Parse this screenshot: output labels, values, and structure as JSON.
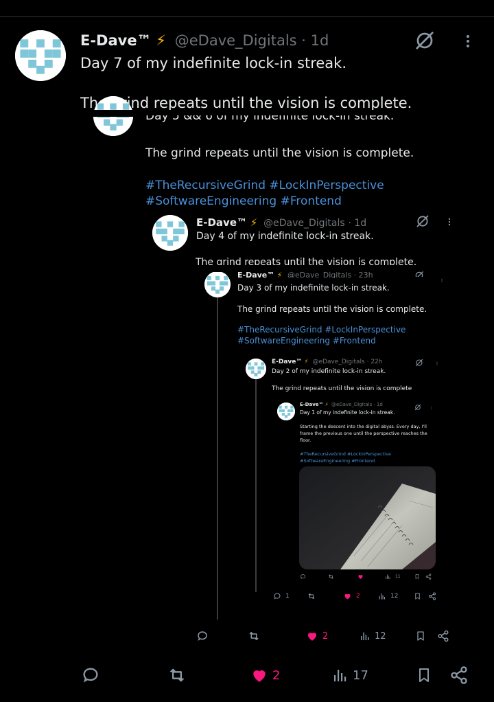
{
  "main": {
    "author": {
      "name": "E-Dave™",
      "bolt": "⚡",
      "handle": "@eDave_Digitals",
      "time": "· 1d"
    },
    "text_line1": "Day 7 of my indefinite lock-in streak.",
    "text_line2": "The grind repeats until the vision is complete.",
    "actions": {
      "likes": "2",
      "views": "17"
    }
  },
  "quote1": {
    "text_line1": "Day 5 && 6 of my indefinite lock-in streak.",
    "text_line2": "The grind repeats until the vision is complete.",
    "tags_line1": "#TheRecursiveGrind #LockInPerspective",
    "tags_line2": "#SoftwareEngineering #Frontend",
    "actions": {
      "likes": "2",
      "views": "12"
    }
  },
  "quote2": {
    "author": {
      "name": "E-Dave™",
      "bolt": "⚡",
      "handle": "@eDave_Digitals",
      "time": "· 1d"
    },
    "text_line1": "Day 4 of my indefinite lock-in streak.",
    "text_line2": "The grind repeats until the vision is complete.",
    "actions": {
      "likes": "2",
      "views": "12"
    }
  },
  "quote3": {
    "author": {
      "name": "E-Dave™",
      "bolt": "⚡",
      "handle": "@eDave_Digitals",
      "time": "· 23h"
    },
    "text_line1": "Day 3 of my indefinite lock-in streak.",
    "text_line2": "The grind repeats until the vision is complete.",
    "tags_line1": "#TheRecursiveGrind #LockInPerspective",
    "tags_line2": "#SoftwareEngineering #Frontend",
    "actions": {
      "replies": "1",
      "likes": "2",
      "views": "12"
    }
  },
  "quote4": {
    "author": {
      "name": "E-Dave™",
      "bolt": "⚡",
      "handle": "@eDave_Digitals",
      "time": "· 22h"
    },
    "text_line1": "Day 2 of my indefinite lock-in streak.",
    "text_line2": "The grind repeats until the vision is complete"
  },
  "quote5": {
    "author": {
      "name": "E-Dave™",
      "bolt": "⚡",
      "handle": "@eDave_Digitals",
      "time": "· 1d"
    },
    "text_line1": "Day 1 of my indefinite lock-in streak.",
    "text_line2": "Starting the descent into the digital abyss. Every day, I'll",
    "text_line3": "frame the previous one until the perspective reaches the",
    "text_line4": "floor.",
    "tags_line1": "#TheRecursiveGrind #LockInPerspective",
    "tags_line2": "#SoftwareEngineering #Frontend",
    "actions": {
      "replies": "",
      "likes": "",
      "views": "11"
    }
  },
  "colors": {
    "background": "#000000",
    "text": "#e7e9ea",
    "muted": "#71767b",
    "link": "#4a90d9",
    "like": "#f91880",
    "bolt": "#f4b400"
  },
  "icons": [
    "grok-icon",
    "more-icon",
    "reply-icon",
    "repost-icon",
    "like-icon",
    "views-icon",
    "bookmark-icon",
    "share-icon",
    "lightning-icon"
  ]
}
